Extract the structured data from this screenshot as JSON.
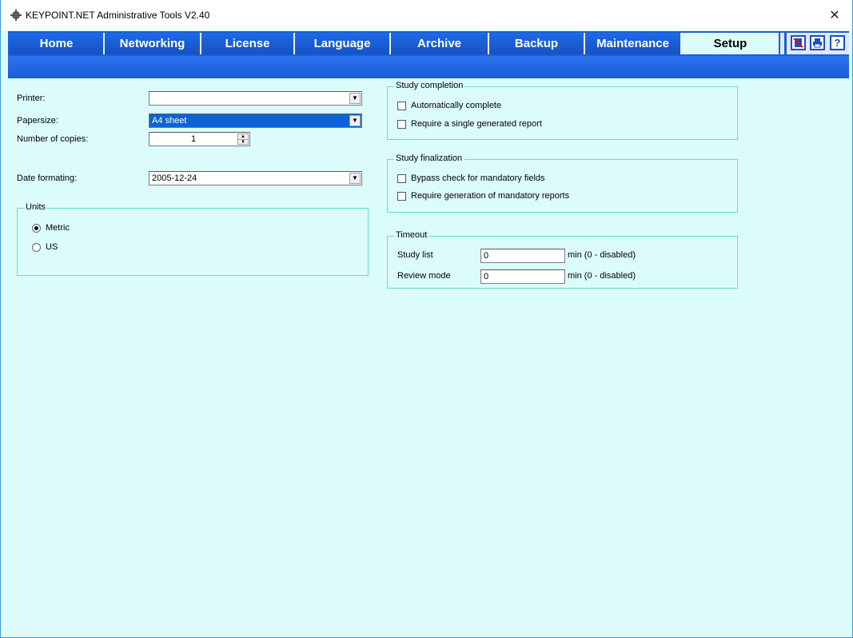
{
  "window": {
    "title": "KEYPOINT.NET Administrative Tools V2.40",
    "close_icon": "close-icon"
  },
  "menu": {
    "tabs": [
      {
        "label": "Home"
      },
      {
        "label": "Networking"
      },
      {
        "label": "License"
      },
      {
        "label": "Language"
      },
      {
        "label": "Archive"
      },
      {
        "label": "Backup"
      },
      {
        "label": "Maintenance"
      },
      {
        "label": "Setup"
      }
    ],
    "active_tab": "Setup",
    "tools": [
      "no-edit-icon",
      "print-icon",
      "help-icon"
    ]
  },
  "setup": {
    "printer": {
      "label": "Printer:",
      "value": ""
    },
    "papersize": {
      "label": "Papersize:",
      "value": "A4 sheet"
    },
    "copies": {
      "label": "Number of copies:",
      "value": "1"
    },
    "date_format": {
      "label": "Date formating:",
      "value": "2005-12-24"
    },
    "units": {
      "legend": "Units",
      "options": [
        {
          "label": "Metric",
          "selected": true
        },
        {
          "label": "US",
          "selected": false
        }
      ]
    },
    "study_completion": {
      "legend": "Study completion",
      "options": [
        {
          "label": "Automatically complete",
          "checked": false
        },
        {
          "label": "Require a single generated report",
          "checked": false
        }
      ]
    },
    "study_finalization": {
      "legend": "Study finalization",
      "options": [
        {
          "label": "Bypass check for mandatory fields",
          "checked": false
        },
        {
          "label": "Require generation of mandatory reports",
          "checked": false
        }
      ]
    },
    "timeout": {
      "legend": "Timeout",
      "rows": [
        {
          "label": "Study list",
          "value": "0",
          "suffix": "min (0 - disabled)"
        },
        {
          "label": "Review mode",
          "value": "0",
          "suffix": "min (0 - disabled)"
        }
      ]
    }
  },
  "colors": {
    "accent": "#1a5fd6",
    "background": "#dcfcfc",
    "selection": "#0a64d6",
    "group_border": "#6cd8d8"
  }
}
